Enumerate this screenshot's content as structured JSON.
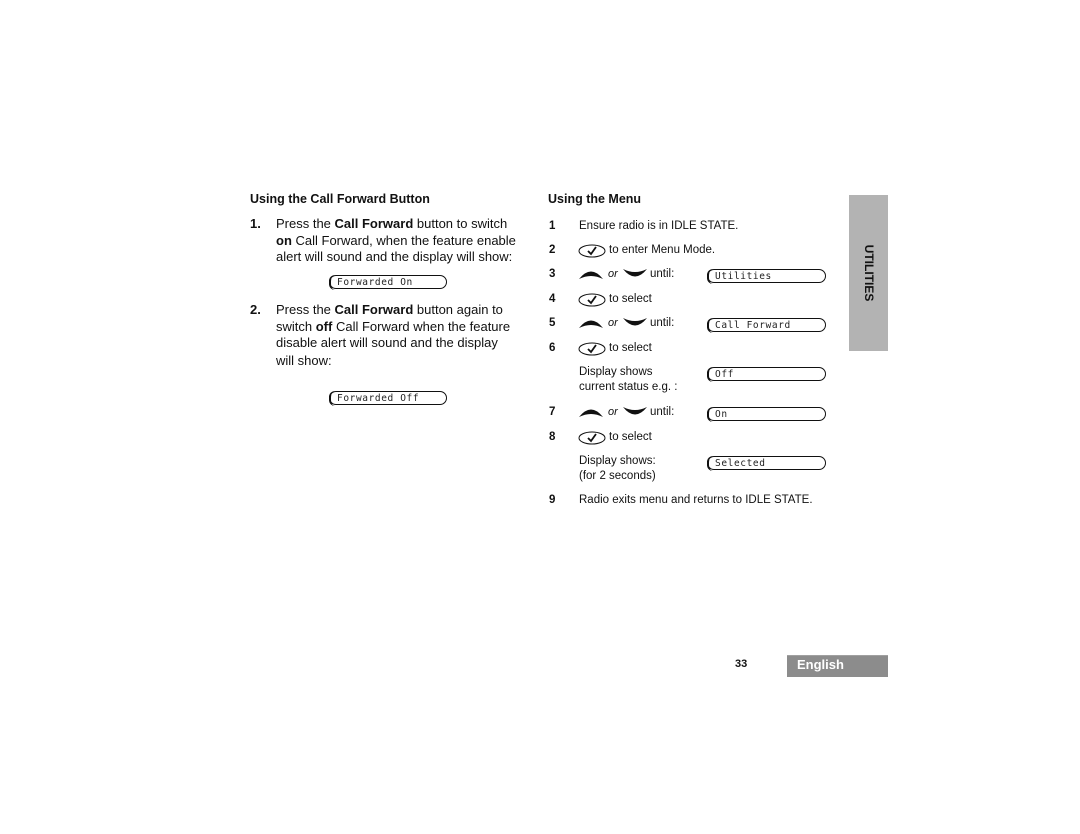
{
  "left": {
    "heading": "Using the Call Forward Button",
    "step1": {
      "num": "1.",
      "line1_a": "Press the ",
      "line1_b": "Call Forward",
      "line1_c": " button to switch",
      "line2_a": "on",
      "line2_b": " Call Forward, when the feature enable",
      "line3": "alert  will sound and the display will show:",
      "display": "Forwarded On"
    },
    "step2": {
      "num": "2.",
      "line1_a": "Press the ",
      "line1_b": "Call Forward",
      "line1_c": " button again to",
      "line2_a": "switch ",
      "line2_b": "off",
      "line2_c": " Call Forward when the feature",
      "line3": "disable alert  will sound and the display",
      "line4": "will show:",
      "display": "Forwarded Off"
    }
  },
  "right": {
    "heading": "Using the Menu",
    "steps": [
      {
        "num": "1",
        "text": "Ensure radio is in IDLE STATE."
      },
      {
        "num": "2",
        "text": "to enter Menu Mode.",
        "icon": "menu-select-key"
      },
      {
        "num": "3",
        "or": "or",
        "until": "until:",
        "display": "Utilities"
      },
      {
        "num": "4",
        "text": "to select",
        "icon": "menu-select-key"
      },
      {
        "num": "5",
        "or": "or",
        "until": "until:",
        "display": "Call Forward"
      },
      {
        "num": "6",
        "text": "to select",
        "icon": "menu-select-key"
      },
      {
        "label1": "Display shows",
        "label2": "current status e.g. :",
        "display": "Off"
      },
      {
        "num": "7",
        "or": "or",
        "until": "until:",
        "display": "On"
      },
      {
        "num": "8",
        "text": "to select",
        "icon": "menu-select-key"
      },
      {
        "label1": "Display shows:",
        "label2": "(for 2 seconds)",
        "display": "Selected"
      },
      {
        "num": "9",
        "text": "Radio exits menu and returns to IDLE STATE."
      }
    ]
  },
  "side_tab": "UTILITIES",
  "footer": {
    "page_number": "33",
    "language": "English"
  }
}
